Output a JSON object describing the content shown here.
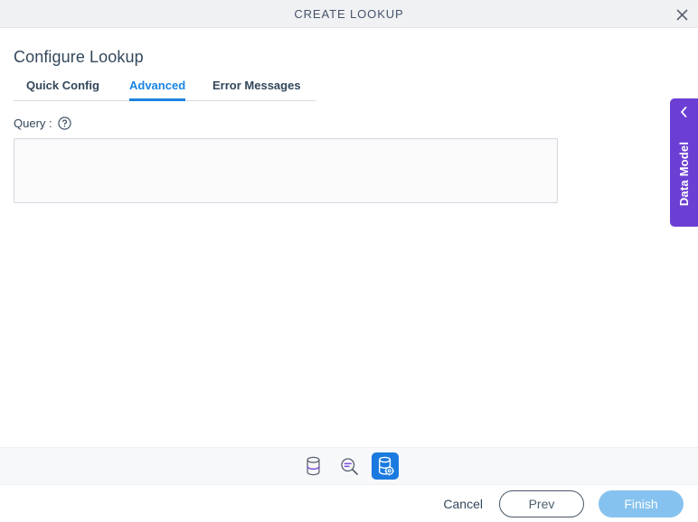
{
  "window": {
    "title": "CREATE LOOKUP",
    "close_icon": "close-icon"
  },
  "page": {
    "heading": "Configure Lookup"
  },
  "tabs": [
    {
      "label": "Quick Config",
      "active": false
    },
    {
      "label": "Advanced",
      "active": true
    },
    {
      "label": "Error Messages",
      "active": false
    }
  ],
  "query_field": {
    "label": "Query :",
    "help_icon": "help-circle-icon",
    "value": "",
    "placeholder": ""
  },
  "data_model_panel": {
    "label": "Data Model",
    "collapse_icon": "chevron-left-icon",
    "color": "#6c3fd4"
  },
  "icon_toolbar": {
    "buttons": [
      {
        "name": "database-icon",
        "title": "Database",
        "active": false
      },
      {
        "name": "query-search-icon",
        "title": "Search Query",
        "active": false
      },
      {
        "name": "database-settings-icon",
        "title": "Database Settings",
        "active": true
      }
    ],
    "active_color": "#1a7ae0"
  },
  "footer": {
    "cancel_label": "Cancel",
    "prev_label": "Prev",
    "finish_label": "Finish"
  }
}
